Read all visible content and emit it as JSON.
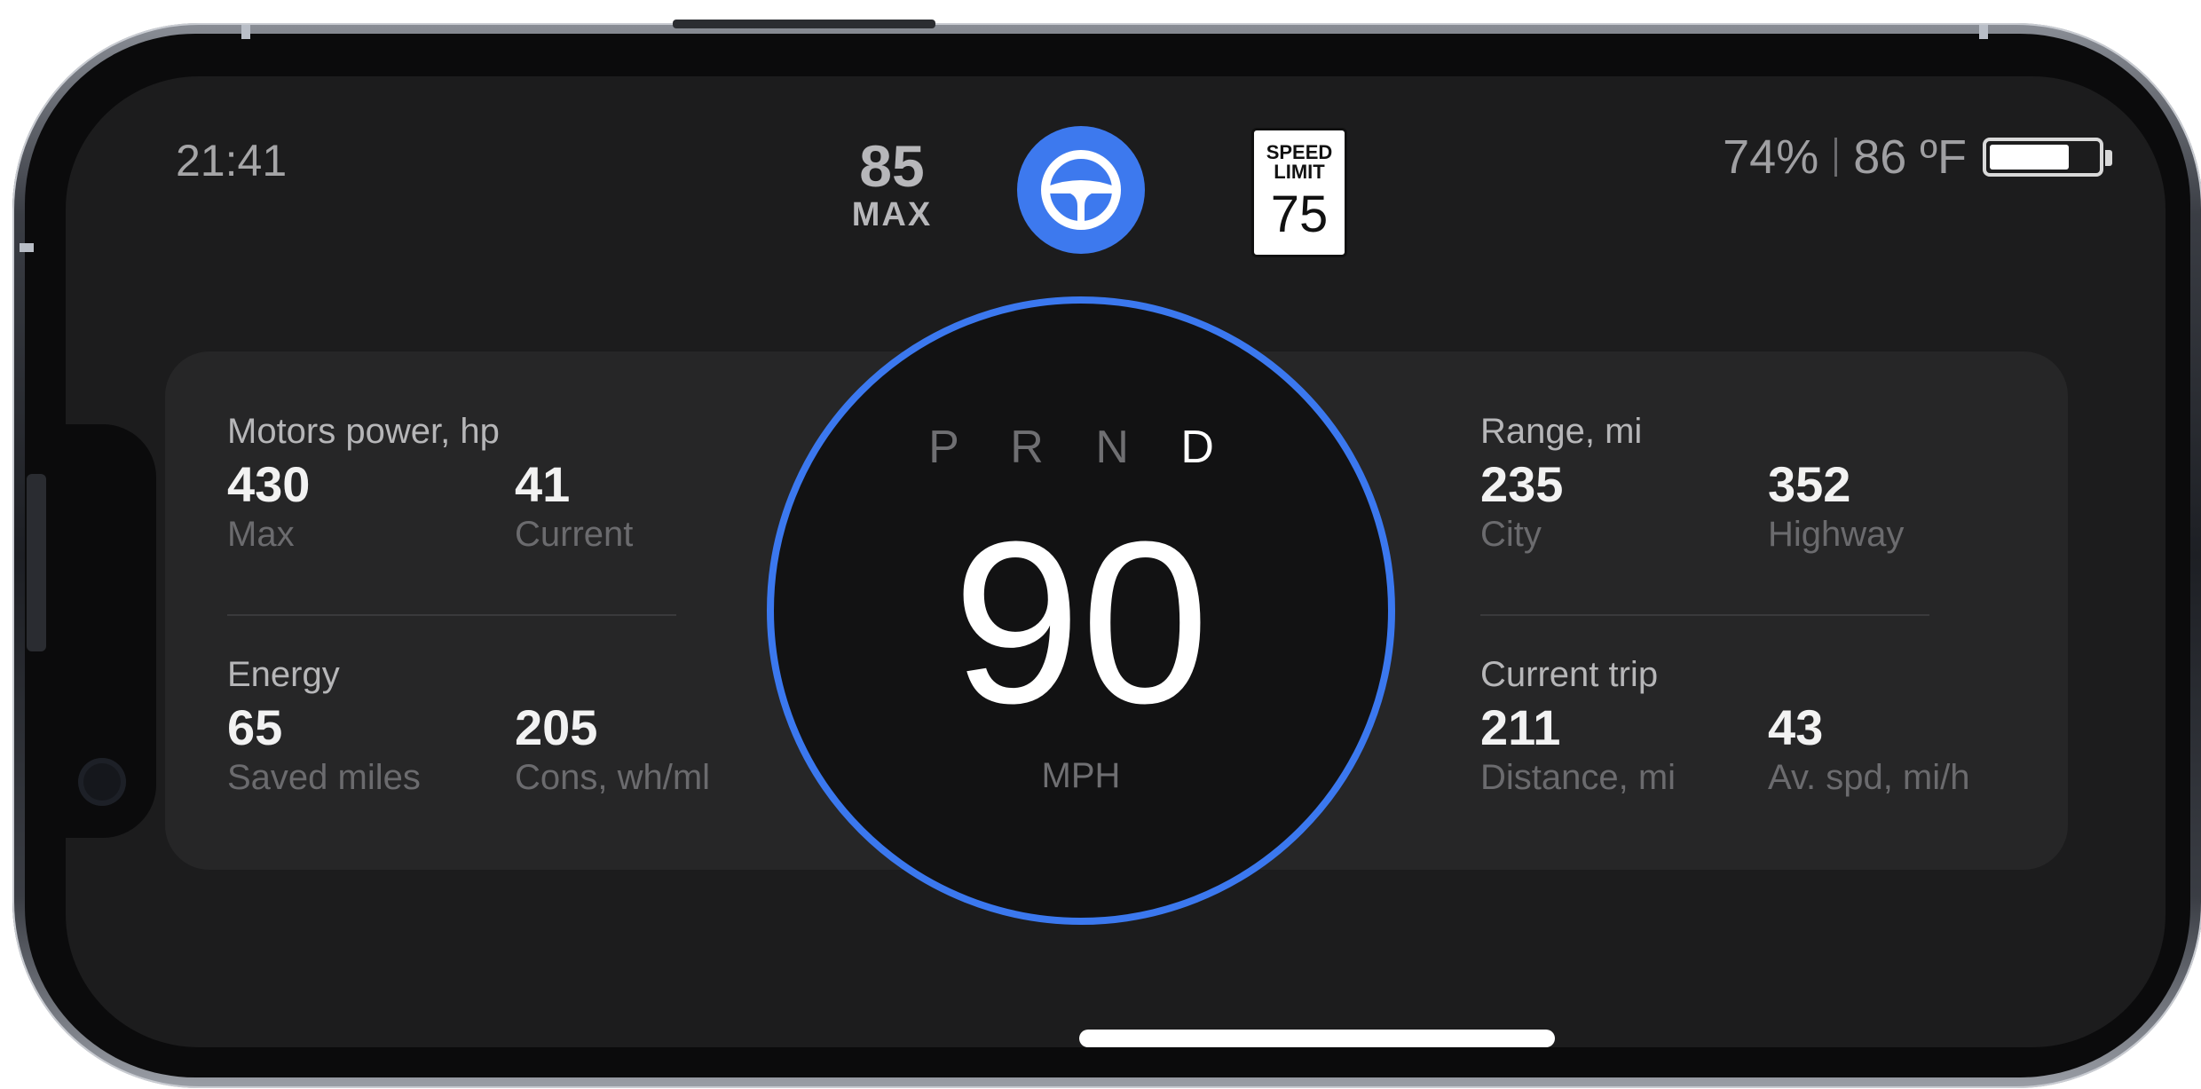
{
  "status": {
    "time": "21:41",
    "battery_percent": "74%",
    "battery_level": 0.74,
    "temperature": "86 ºF"
  },
  "top": {
    "max_speed": "85",
    "max_label": "MAX",
    "autopilot_icon": "steering-wheel-icon",
    "autopilot_color": "#3d79ee",
    "speed_limit_title": "SPEED LIMIT",
    "speed_limit_value": "75"
  },
  "left": {
    "motors": {
      "title": "Motors power, hp",
      "stats": [
        {
          "value": "430",
          "label": "Max"
        },
        {
          "value": "41",
          "label": "Current"
        }
      ]
    },
    "energy": {
      "title": "Energy",
      "stats": [
        {
          "value": "65",
          "label": "Saved miles"
        },
        {
          "value": "205",
          "label": "Cons, wh/ml"
        }
      ]
    }
  },
  "right": {
    "range": {
      "title": "Range, mi",
      "stats": [
        {
          "value": "235",
          "label": "City"
        },
        {
          "value": "352",
          "label": "Highway"
        }
      ]
    },
    "trip": {
      "title": "Current trip",
      "stats": [
        {
          "value": "211",
          "label": "Distance, mi"
        },
        {
          "value": "43",
          "label": "Av. spd, mi/h"
        }
      ]
    }
  },
  "gauge": {
    "gears": [
      "P",
      "R",
      "N",
      "D"
    ],
    "active_gear": "D",
    "speed": "90",
    "unit": "MPH",
    "ring_color": "#3b78ef"
  }
}
